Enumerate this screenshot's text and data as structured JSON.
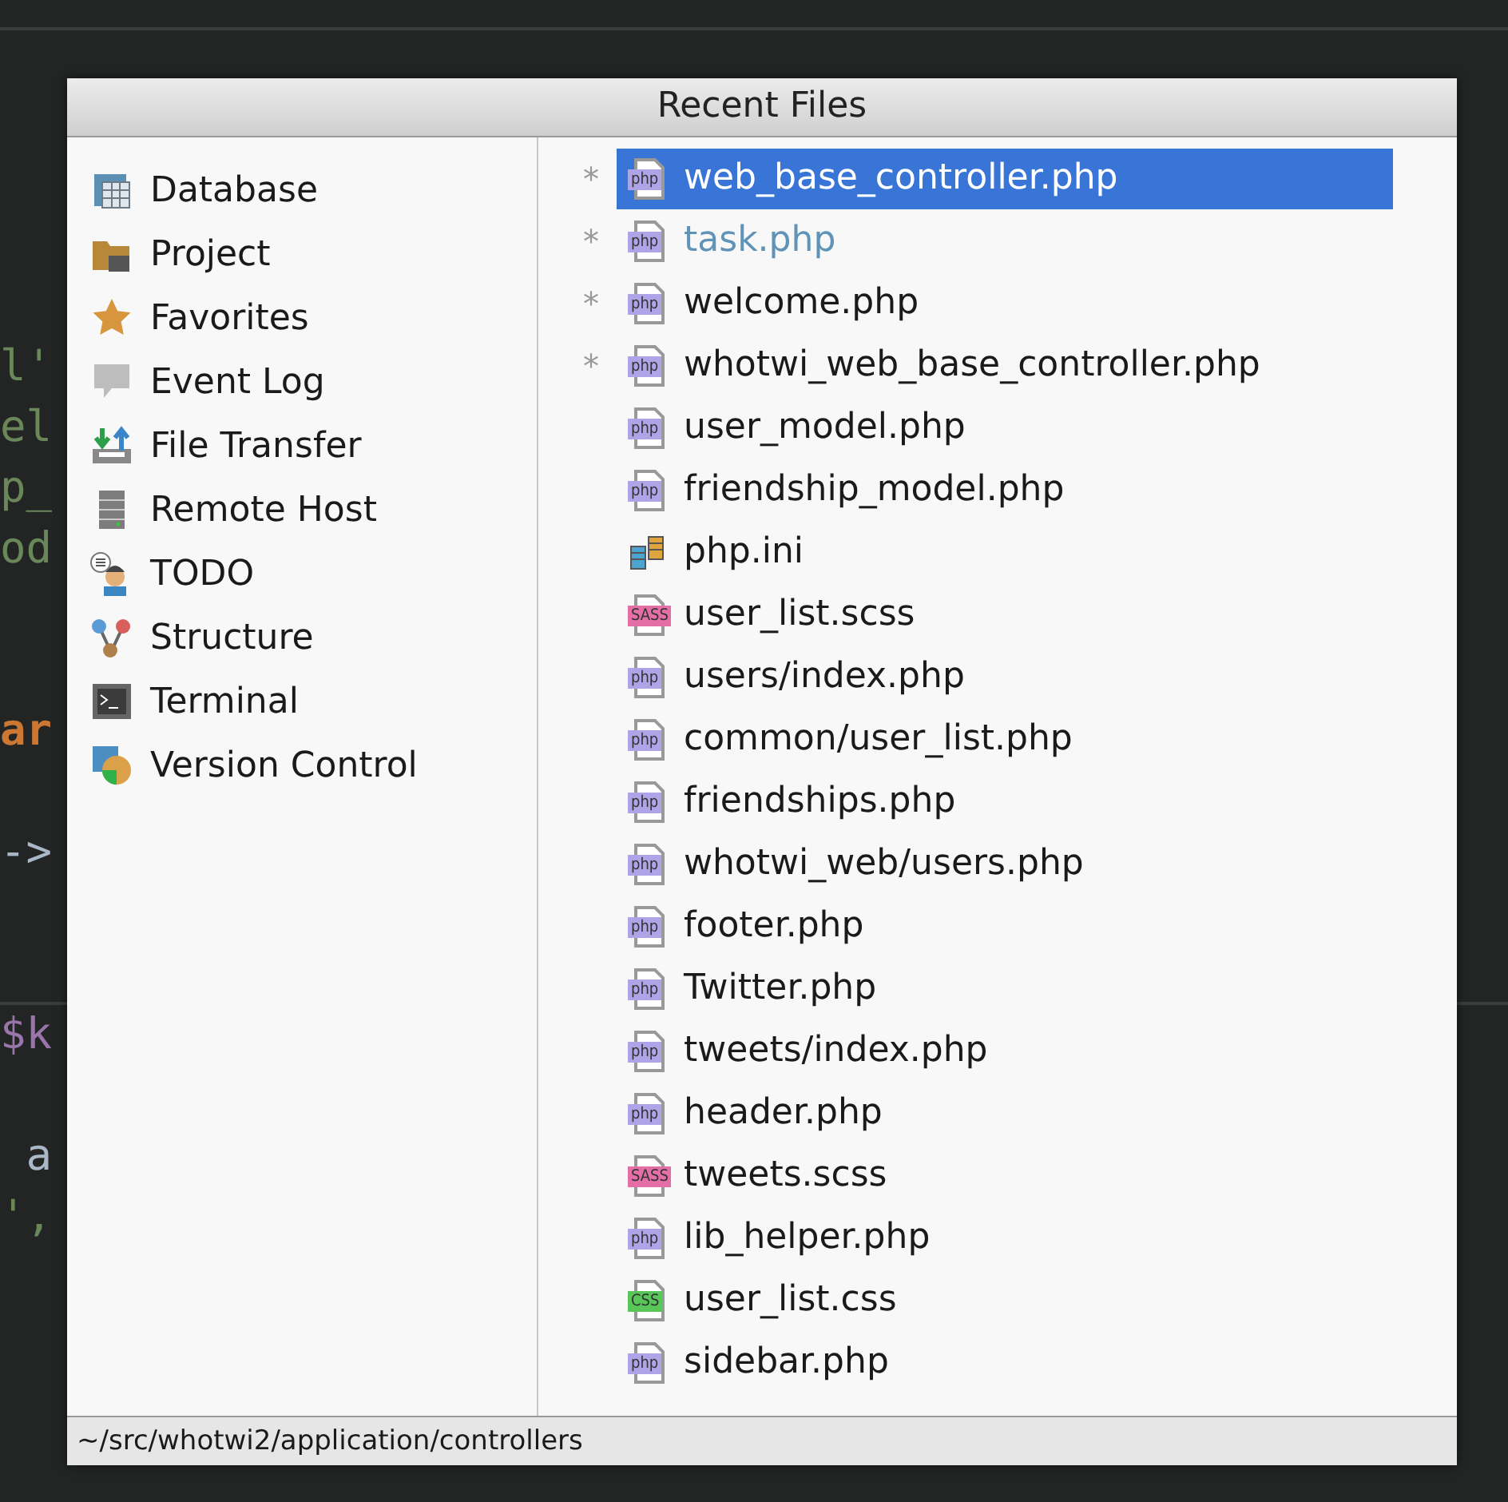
{
  "editor": {
    "lines": [
      {
        "kind": "string",
        "text": "l'"
      },
      {
        "kind": "string",
        "text": "el"
      },
      {
        "kind": "string",
        "text": "p_"
      },
      {
        "kind": "string",
        "text": "od"
      },
      {
        "kind": "blank"
      },
      {
        "kind": "blank"
      },
      {
        "kind": "keyword",
        "text": "ar"
      },
      {
        "kind": "blank"
      },
      {
        "kind": "plain",
        "text": "->"
      },
      {
        "kind": "blank"
      },
      {
        "kind": "blank"
      },
      {
        "kind": "variable",
        "text": "$k"
      },
      {
        "kind": "blank"
      },
      {
        "kind": "plain",
        "text": " a"
      },
      {
        "kind": "string",
        "text": "',"
      }
    ]
  },
  "popup": {
    "title": "Recent Files",
    "tool_windows": [
      {
        "kind": "database",
        "label": "Database"
      },
      {
        "kind": "project",
        "label": "Project"
      },
      {
        "kind": "favorites",
        "label": "Favorites"
      },
      {
        "kind": "eventlog",
        "label": "Event Log"
      },
      {
        "kind": "transfer",
        "label": "File Transfer"
      },
      {
        "kind": "server",
        "label": "Remote Host"
      },
      {
        "kind": "todo",
        "label": "TODO"
      },
      {
        "kind": "structure",
        "label": "Structure"
      },
      {
        "kind": "terminal",
        "label": "Terminal"
      },
      {
        "kind": "vcs",
        "label": "Version Control"
      }
    ],
    "files": [
      {
        "name": "web_base_controller.php",
        "kind": "php",
        "badge": "php",
        "modified": true,
        "selected": true
      },
      {
        "name": "task.php",
        "kind": "php",
        "badge": "php",
        "modified": true,
        "selected": false,
        "color": "#5f93b8"
      },
      {
        "name": "welcome.php",
        "kind": "php",
        "badge": "php",
        "modified": true,
        "selected": false,
        "color": "#1a1a1a"
      },
      {
        "name": "whotwi_web_base_controller.php",
        "kind": "php",
        "badge": "php",
        "modified": true,
        "selected": false,
        "color": "#1a1a1a"
      },
      {
        "name": "user_model.php",
        "kind": "php",
        "badge": "php",
        "modified": false,
        "selected": false,
        "color": "#1a1a1a"
      },
      {
        "name": "friendship_model.php",
        "kind": "php",
        "badge": "php",
        "modified": false,
        "selected": false,
        "color": "#1a1a1a"
      },
      {
        "name": "php.ini",
        "kind": "ini",
        "modified": false,
        "selected": false,
        "color": "#1a1a1a"
      },
      {
        "name": "user_list.scss",
        "kind": "sass",
        "badge": "SASS",
        "modified": false,
        "selected": false,
        "color": "#1a1a1a"
      },
      {
        "name": "users/index.php",
        "kind": "php",
        "badge": "php",
        "modified": false,
        "selected": false,
        "color": "#1a1a1a"
      },
      {
        "name": "common/user_list.php",
        "kind": "php",
        "badge": "php",
        "modified": false,
        "selected": false,
        "color": "#1a1a1a"
      },
      {
        "name": "friendships.php",
        "kind": "php",
        "badge": "php",
        "modified": false,
        "selected": false,
        "color": "#1a1a1a"
      },
      {
        "name": "whotwi_web/users.php",
        "kind": "php",
        "badge": "php",
        "modified": false,
        "selected": false,
        "color": "#1a1a1a"
      },
      {
        "name": "footer.php",
        "kind": "php",
        "badge": "php",
        "modified": false,
        "selected": false,
        "color": "#1a1a1a"
      },
      {
        "name": "Twitter.php",
        "kind": "php",
        "badge": "php",
        "modified": false,
        "selected": false,
        "color": "#1a1a1a"
      },
      {
        "name": "tweets/index.php",
        "kind": "php",
        "badge": "php",
        "modified": false,
        "selected": false,
        "color": "#1a1a1a"
      },
      {
        "name": "header.php",
        "kind": "php",
        "badge": "php",
        "modified": false,
        "selected": false,
        "color": "#1a1a1a"
      },
      {
        "name": "tweets.scss",
        "kind": "sass",
        "badge": "SASS",
        "modified": false,
        "selected": false,
        "color": "#1a1a1a"
      },
      {
        "name": "lib_helper.php",
        "kind": "php",
        "badge": "php",
        "modified": false,
        "selected": false,
        "color": "#1a1a1a"
      },
      {
        "name": "user_list.css",
        "kind": "css",
        "badge": "CSS",
        "modified": false,
        "selected": false,
        "color": "#1a1a1a"
      },
      {
        "name": "sidebar.php",
        "kind": "php",
        "badge": "php",
        "modified": false,
        "selected": false,
        "color": "#1a1a1a"
      }
    ],
    "modified_mark": "*",
    "status_path": "~/src/whotwi2/application/controllers"
  }
}
